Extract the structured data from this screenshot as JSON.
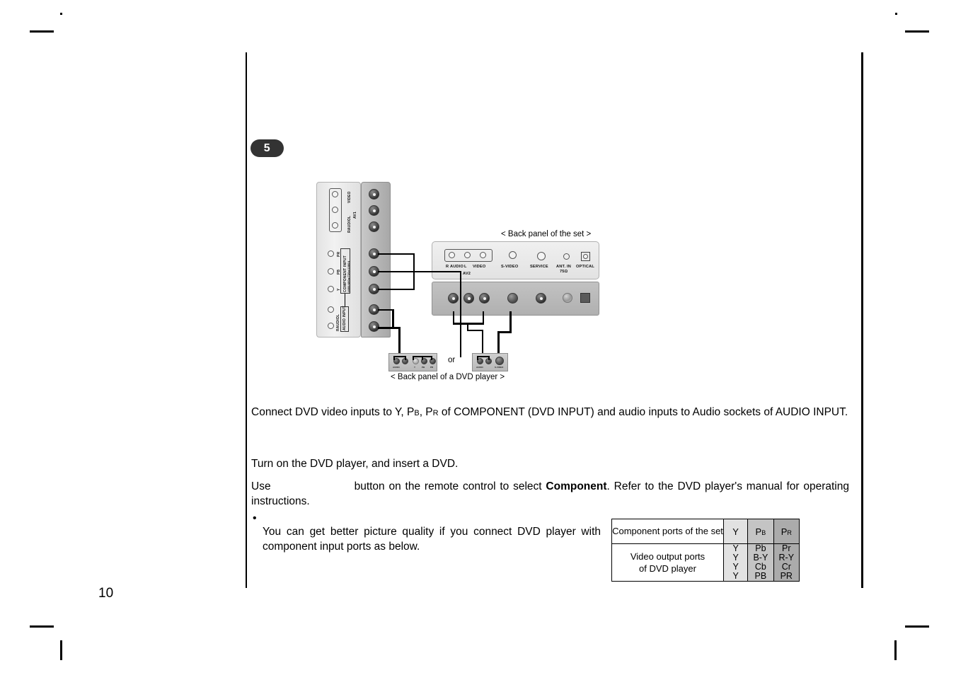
{
  "page": {
    "number": "10",
    "step_badge": "5"
  },
  "diagram": {
    "caption_back_panel_set": "< Back panel of the set >",
    "caption_back_panel_dvd": "< Back panel of a DVD player >",
    "or_label": "or",
    "side_panel": {
      "av1_label": "AV1",
      "video_label": "VIDEO",
      "audio_label": "AUDIO",
      "audio_r": "R",
      "audio_l": "L",
      "component_input_label": "COMPONENT INPUT",
      "component_input_formats": "(480i/480p/720p/1080i)",
      "component_pr": "PR",
      "component_pb": "PB",
      "component_y": "Y",
      "audio_input_label": "AUDIO INPUT"
    },
    "back_panel": {
      "av2_label": "AV2",
      "audio_r": "R",
      "audio_label": "AUDIO",
      "audio_l": "L",
      "video_label": "VIDEO",
      "svideo_label": "S-VIDEO",
      "service_label": "SERVICE",
      "ant_in_label": "ANT. IN",
      "ant_in_ohm": "75Ω",
      "optical_label": "OPTICAL"
    },
    "dvd_panel_left": {
      "audio_label": "AUDIO",
      "audio_r": "R",
      "audio_l": "L",
      "component_y": "Y",
      "component_pb": "PB",
      "component_pr": "PR"
    },
    "dvd_panel_right": {
      "audio_label": "AUDIO",
      "audio_r": "R",
      "audio_l": "L",
      "svideo_label": "S-VIDEO"
    }
  },
  "body": {
    "para1_a": "Connect DVD video inputs to Y, P",
    "para1_sub_b": "B",
    "para1_b": ", P",
    "para1_sub_r": "R",
    "para1_c": " of COMPONENT (DVD INPUT) and audio inputs to Audio sockets of AUDIO INPUT.",
    "para2": "Turn on the DVD player, and insert a DVD.",
    "para3_use": "Use",
    "para3_mid": "button on the remote control to select ",
    "para3_bold": "Component",
    "para3_end": ". Refer to the DVD player's manual for operating instructions.",
    "bullet_marker": "•",
    "bullet_text": "You can get better picture quality if you connect DVD player with component input ports as below."
  },
  "table": {
    "row1_label": "Component ports of the set",
    "row1_y": "Y",
    "row1_pb_main": "P",
    "row1_pb_sub": "B",
    "row1_pr_main": "P",
    "row1_pr_sub": "R",
    "row2_label_line1": "Video output ports",
    "row2_label_line2": "of DVD player",
    "col_y": [
      "Y",
      "Y",
      "Y",
      "Y"
    ],
    "col_pb": [
      "Pb",
      "B-Y",
      "Cb",
      "PB"
    ],
    "col_pr": [
      "Pr",
      "R-Y",
      "Cr",
      "PR"
    ]
  }
}
